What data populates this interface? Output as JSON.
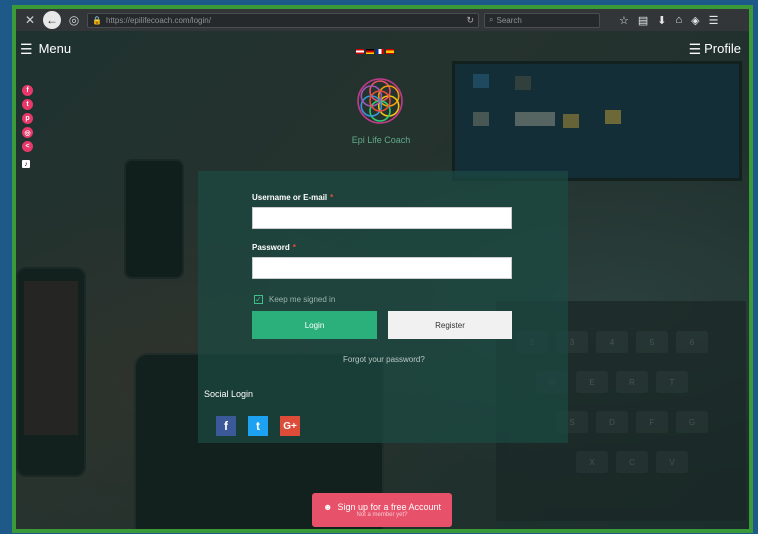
{
  "browser": {
    "url": "https://epilifecoach.com/login/",
    "search_placeholder": "Search"
  },
  "site": {
    "menu_label": "Menu",
    "profile_label": "Profile",
    "brand_name": "Epi Life Coach"
  },
  "login": {
    "username_label": "Username or E-mail",
    "username_required": "*",
    "password_label": "Password",
    "password_required": "*",
    "remember_label": "Keep me signed in",
    "login_button": "Login",
    "register_button": "Register",
    "forgot_link": "Forgot your password?",
    "social_title": "Social Login"
  },
  "signup": {
    "label": "Sign up for a free Account",
    "sublabel": "Not a member yet?"
  },
  "colors": {
    "accent_green": "#2bb07b",
    "signup_pink": "#e8516a",
    "social_pink": "#e7386a"
  },
  "icons": {
    "social_icons": [
      "facebook-icon",
      "twitter-icon",
      "pinterest-icon",
      "instagram-icon",
      "share-icon",
      "tiktok-icon"
    ]
  }
}
